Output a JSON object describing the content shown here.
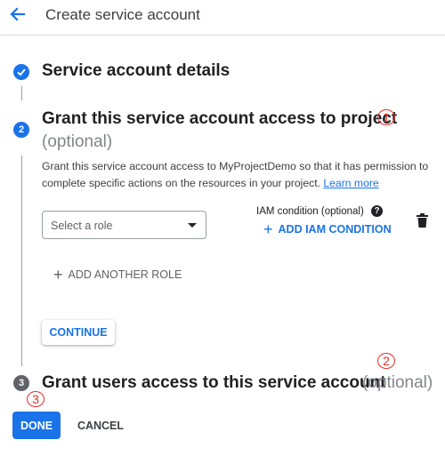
{
  "header": {
    "title": "Create service account"
  },
  "steps": [
    {
      "number": "✓",
      "title": "Service account details",
      "optional": "",
      "state": "complete"
    },
    {
      "number": "2",
      "title": "Grant this service account access to project",
      "optional": "(optional)",
      "state": "active"
    },
    {
      "number": "3",
      "title": "Grant users access to this service account",
      "optional": "(optional)",
      "state": "pending"
    }
  ],
  "step2": {
    "description": "Grant this service account access to MyProjectDemo so that it has permission to complete specific actions on the resources in your project.",
    "learn_more": "Learn more",
    "role_placeholder": "Select a role",
    "iam_condition_label": "IAM condition (optional)",
    "add_iam_condition": "ADD IAM CONDITION",
    "add_another_role": "ADD ANOTHER ROLE",
    "continue_label": "CONTINUE"
  },
  "footer": {
    "done_label": "DONE",
    "cancel_label": "CANCEL"
  },
  "annotations": [
    "1",
    "2",
    "3"
  ],
  "colors": {
    "primary": "#1a73e8",
    "step_done": "#1a73e8",
    "step_pending": "#5f6368",
    "annotation": "#e8302a"
  }
}
